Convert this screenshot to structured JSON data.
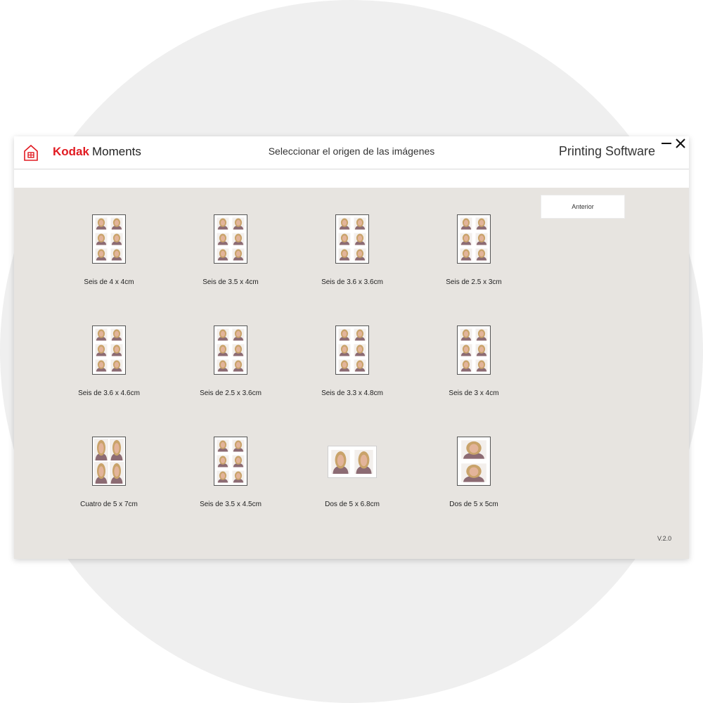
{
  "header": {
    "brand_bold": "Kodak",
    "brand_rest": "Moments",
    "title": "Seleccionar el origen de las imágenes",
    "app_title": "Printing Software",
    "home_icon": "home-icon",
    "minimize_icon": "minimize-icon",
    "close_icon": "close-icon"
  },
  "colors": {
    "brand_red": "#e11b22",
    "content_bg": "#e7e4e0",
    "photo_bg": "#a88a8a",
    "skin": "#e3b49a",
    "hair": "#c9a36a",
    "shirt": "#8c6b73"
  },
  "nav": {
    "back_label": "Anterior"
  },
  "footer": {
    "version": "V.2.0"
  },
  "layouts": [
    {
      "label": "Seis de 4 x 4cm",
      "cols": 2,
      "rows": 3,
      "orientation": "portrait"
    },
    {
      "label": "Seis de 3.5 x 4cm",
      "cols": 2,
      "rows": 3,
      "orientation": "portrait"
    },
    {
      "label": "Seis de 3.6 x 3.6cm",
      "cols": 2,
      "rows": 3,
      "orientation": "portrait"
    },
    {
      "label": "Seis de 2.5 x 3cm",
      "cols": 2,
      "rows": 3,
      "orientation": "portrait"
    },
    {
      "label": "Seis de 3.6 x 4.6cm",
      "cols": 2,
      "rows": 3,
      "orientation": "portrait"
    },
    {
      "label": "Seis de 2.5 x 3.6cm",
      "cols": 2,
      "rows": 3,
      "orientation": "portrait"
    },
    {
      "label": "Seis de 3.3 x 4.8cm",
      "cols": 2,
      "rows": 3,
      "orientation": "portrait"
    },
    {
      "label": "Seis de 3 x 4cm",
      "cols": 2,
      "rows": 3,
      "orientation": "portrait"
    },
    {
      "label": "Cuatro de 5 x 7cm",
      "cols": 2,
      "rows": 2,
      "orientation": "portrait"
    },
    {
      "label": "Seis de 3.5 x 4.5cm",
      "cols": 2,
      "rows": 3,
      "orientation": "portrait"
    },
    {
      "label": "Dos de 5 x 6.8cm",
      "cols": 2,
      "rows": 1,
      "orientation": "landscape"
    },
    {
      "label": "Dos de 5 x 5cm",
      "cols": 1,
      "rows": 2,
      "orientation": "portrait"
    }
  ]
}
